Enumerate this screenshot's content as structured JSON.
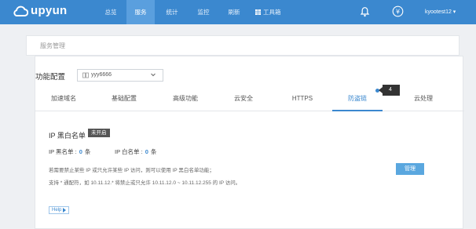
{
  "brand": {
    "name": "upyun"
  },
  "nav": {
    "items": [
      "总览",
      "服务",
      "统计",
      "监控",
      "刷新"
    ],
    "active": "服务",
    "tools_label": "工具箱",
    "user": "kyootest12 ▾"
  },
  "breadcrumb": "服务管理",
  "config": {
    "label": "功能配置",
    "selected_service": "yyy6666"
  },
  "tabs": [
    {
      "label": "加速域名"
    },
    {
      "label": "基础配置"
    },
    {
      "label": "高级功能"
    },
    {
      "label": "云安全"
    },
    {
      "label": "HTTPS"
    },
    {
      "label": "防盗链"
    },
    {
      "label": "云处理"
    }
  ],
  "active_tab": "防盗链",
  "tab_badge": "4",
  "ip_section": {
    "title": "IP 黑白名单",
    "status": "未开启",
    "blacklist_label": "IP 黑名单 :",
    "blacklist_count": "0",
    "blacklist_unit": "条",
    "whitelist_label": "IP 白名单 :",
    "whitelist_count": "0",
    "whitelist_unit": "条",
    "desc1": "若需要禁止某些 IP 或只允许某些 IP 访问，则可以使用 IP 黑白名单功能；",
    "desc2": "支持 * 通配符，如 10.11.12.* 将禁止或只允许 10.11.12.0 ~ 10.11.12.255 的 IP 访问。",
    "manage_label": "管理",
    "help_label": "Help"
  },
  "colors": {
    "primary": "#3b88cf",
    "topbar": "#3b88cf"
  }
}
